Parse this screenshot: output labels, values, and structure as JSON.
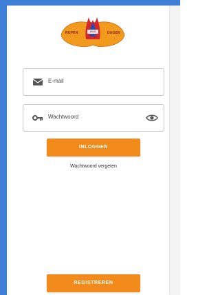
{
  "logo": {
    "left_text": "RUPEN",
    "right_text": "DAGEN",
    "center_text": "2018"
  },
  "email": {
    "placeholder": "E-mail"
  },
  "password": {
    "placeholder": "Wachtwoord"
  },
  "buttons": {
    "login": "INLOGGEN",
    "register": "REGISTREREN"
  },
  "forgot_password": "Wachtwoord vergeten",
  "colors": {
    "accent": "#f28a1b",
    "frame": "#3d7fd6",
    "logo_orange": "#f29a1e",
    "logo_red": "#d4262c",
    "logo_blue": "#2c4aa8"
  },
  "icons": {
    "email": "envelope-icon",
    "password": "key-icon",
    "toggle": "eye-icon"
  }
}
